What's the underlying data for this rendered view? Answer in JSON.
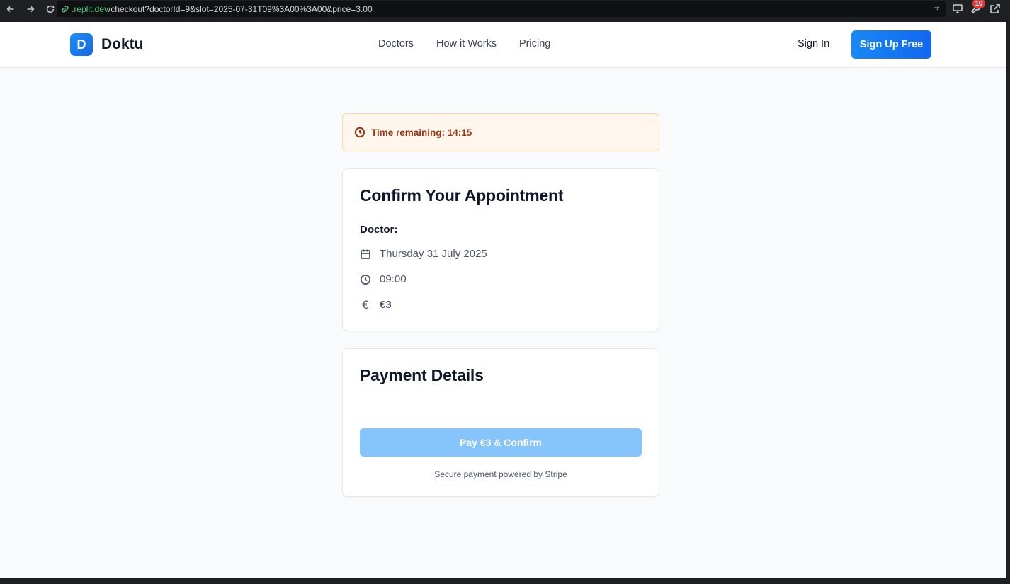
{
  "browser": {
    "url_host": ".replit.dev",
    "url_path": "/checkout?doctorId=9&slot=2025-07-31T09%3A00%3A00&price=3.00",
    "badge_count": "10"
  },
  "header": {
    "logo_letter": "D",
    "brand": "Doktu",
    "nav": [
      "Doctors",
      "How it Works",
      "Pricing"
    ],
    "sign_in": "Sign In",
    "sign_up": "Sign Up Free"
  },
  "timer": {
    "text": "Time remaining: 14:15"
  },
  "appointment": {
    "title": "Confirm Your Appointment",
    "doctor_label": "Doctor:",
    "date": "Thursday 31 July 2025",
    "time": "09:00",
    "price": "€3",
    "currency_glyph": "€"
  },
  "payment": {
    "title": "Payment Details",
    "button": "Pay €3 & Confirm",
    "secure_note": "Secure payment powered by Stripe"
  },
  "colors": {
    "primary": "#1769e0",
    "button_disabled": "#86c5fb",
    "timer_bg": "#fff7ed",
    "timer_text": "#9a3412"
  }
}
